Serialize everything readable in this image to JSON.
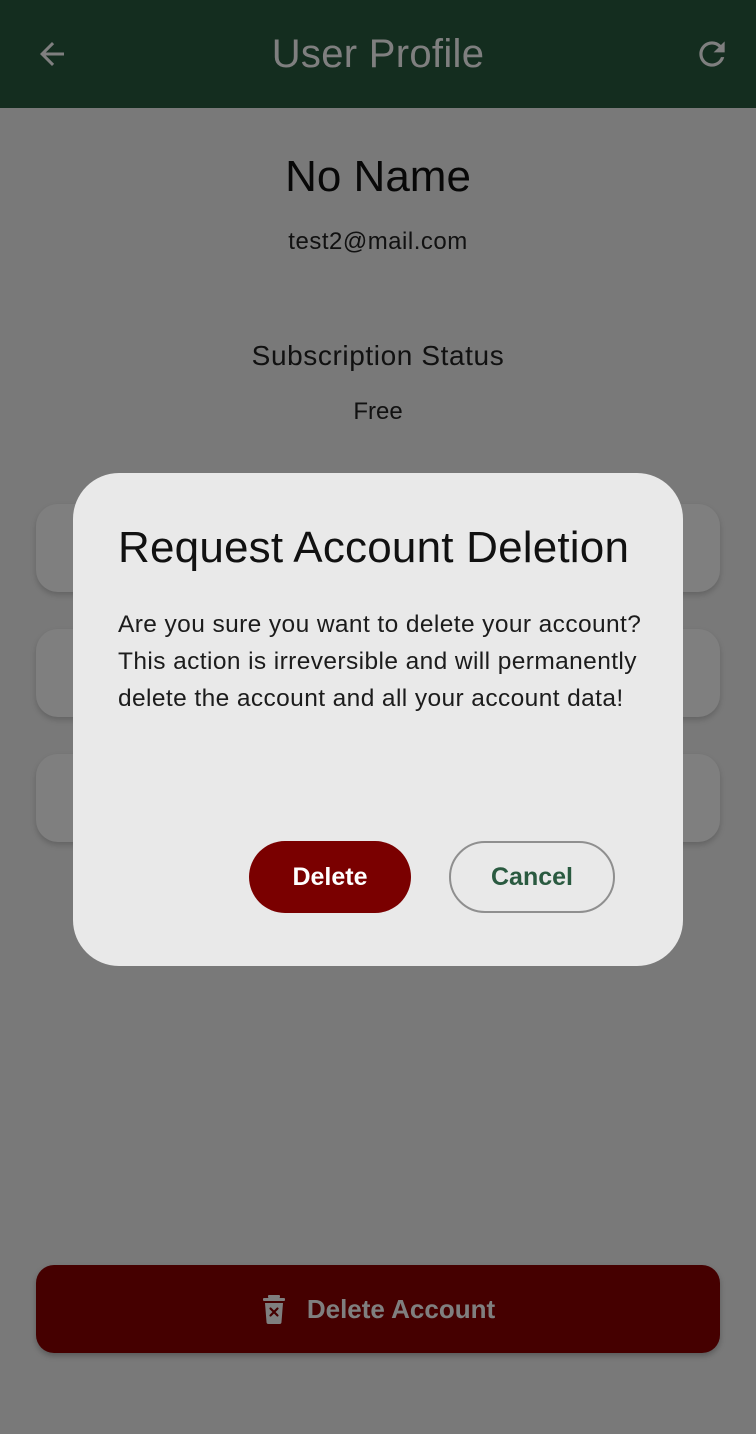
{
  "appbar": {
    "title": "User Profile",
    "back_icon": "arrow-left-icon",
    "refresh_icon": "refresh-icon"
  },
  "profile": {
    "name": "No Name",
    "email": "test2@mail.com",
    "subscription_label": "Subscription Status",
    "subscription_value": "Free"
  },
  "footer": {
    "delete_account_label": "Delete Account",
    "delete_icon": "trash-icon"
  },
  "dialog": {
    "title": "Request Account Deletion",
    "body_line1": "Are you sure you want to delete your account?",
    "body_line2": "This action is irreversible and will permanently delete the account and all your account data!",
    "delete_label": "Delete",
    "cancel_label": "Cancel"
  },
  "colors": {
    "appbar": "#285a3f",
    "danger": "#7a0000",
    "cancel_text": "#2a5a40",
    "dialog_bg": "#e9e9e9"
  }
}
